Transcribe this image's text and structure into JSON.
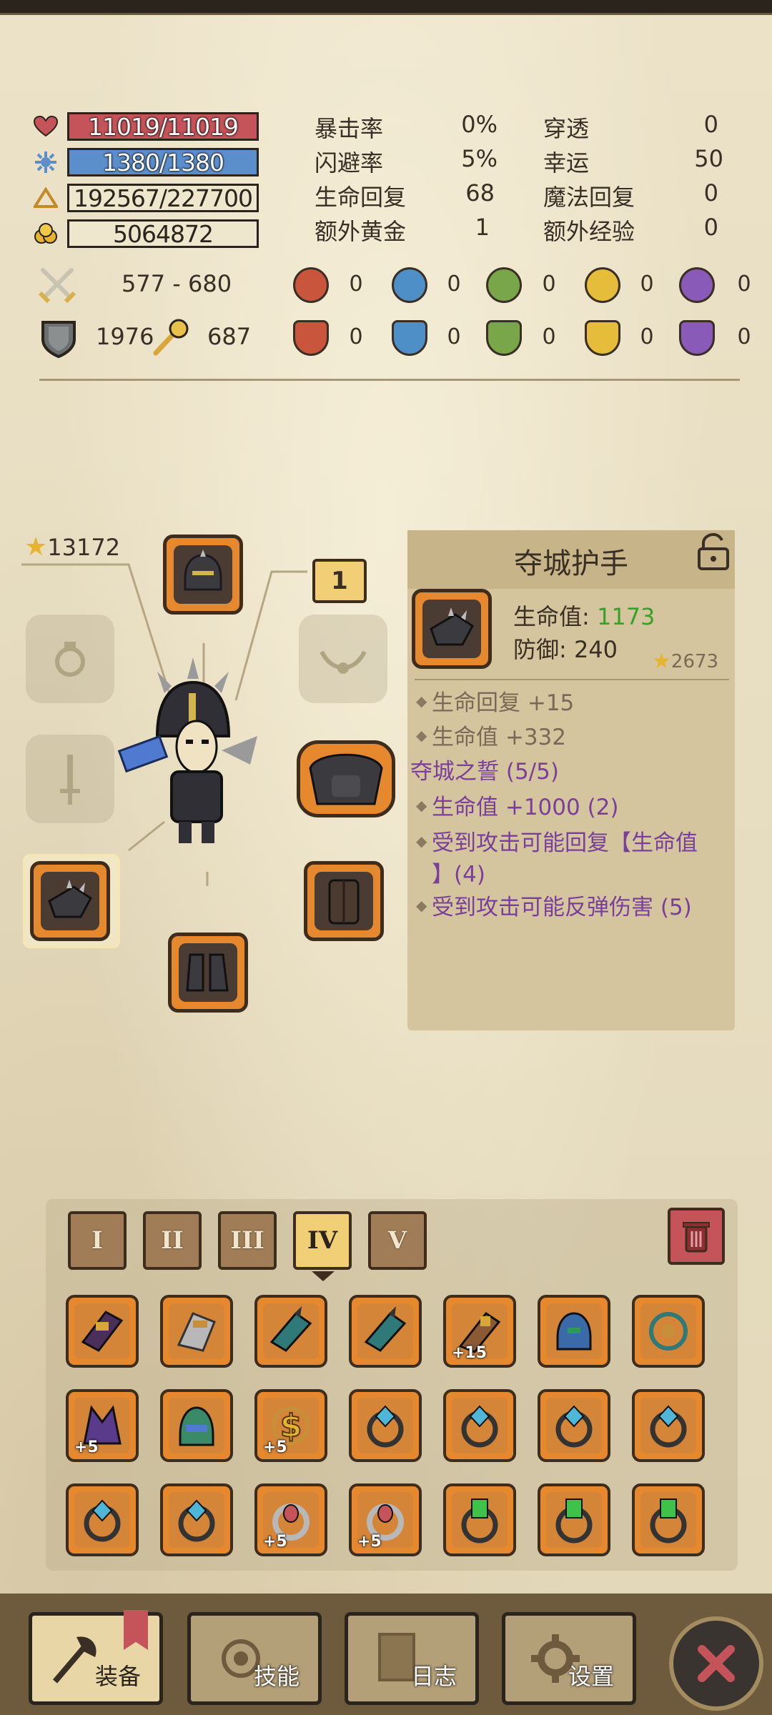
{
  "stats": {
    "hp": "11019/11019",
    "mp": "1380/1380",
    "xp": "192567/227700",
    "gold": "5064872",
    "crit_label": "暴击率",
    "crit_value": "0%",
    "pierce_label": "穿透",
    "pierce_value": "0",
    "dodge_label": "闪避率",
    "dodge_value": "5%",
    "luck_label": "幸运",
    "luck_value": "50",
    "hp_regen_label": "生命回复",
    "hp_regen_value": "68",
    "mp_regen_label": "魔法回复",
    "mp_regen_value": "0",
    "extra_gold_label": "额外黄金",
    "extra_gold_value": "1",
    "extra_xp_label": "额外经验",
    "extra_xp_value": "0",
    "attack": "577 - 680",
    "armor": "1976",
    "magic_power": "687",
    "elem_attack": [
      "0",
      "0",
      "0",
      "0",
      "0"
    ],
    "elem_resist": [
      "0",
      "0",
      "0",
      "0",
      "0"
    ]
  },
  "equipment": {
    "power_score": "13172",
    "page_number": "1"
  },
  "detail": {
    "title": "夺城护手",
    "hp_label": "生命值: ",
    "hp_value": "1173",
    "def_label": "防御: 240",
    "score": "2673",
    "attr1": "生命回复 +15",
    "attr2": "生命值 +332",
    "set_name": "夺城之誓 (5/5)",
    "set1": "生命值 +1000 (2)",
    "set2a": "受到攻击可能回复【生命值",
    "set2b": "】(4)",
    "set3": "受到攻击可能反弹伤害 (5)"
  },
  "inventory": {
    "tabs": [
      "I",
      "II",
      "III",
      "IV",
      "V"
    ],
    "active_tab": "IV",
    "badges": {
      "r1c5": "+15",
      "r2c1": "+5",
      "r2c3": "+5",
      "r3c3": "+5",
      "r3c4": "+5"
    }
  },
  "nav": {
    "equip": "装备",
    "skills": "技能",
    "log": "日志",
    "settings": "设置"
  },
  "colors": {
    "hp_bar": "#c4545a",
    "mp_bar": "#5b8fcb",
    "slot_orange": "#e6882e",
    "set_purple": "#7a3f9a",
    "hp_green": "#3aa02a"
  }
}
